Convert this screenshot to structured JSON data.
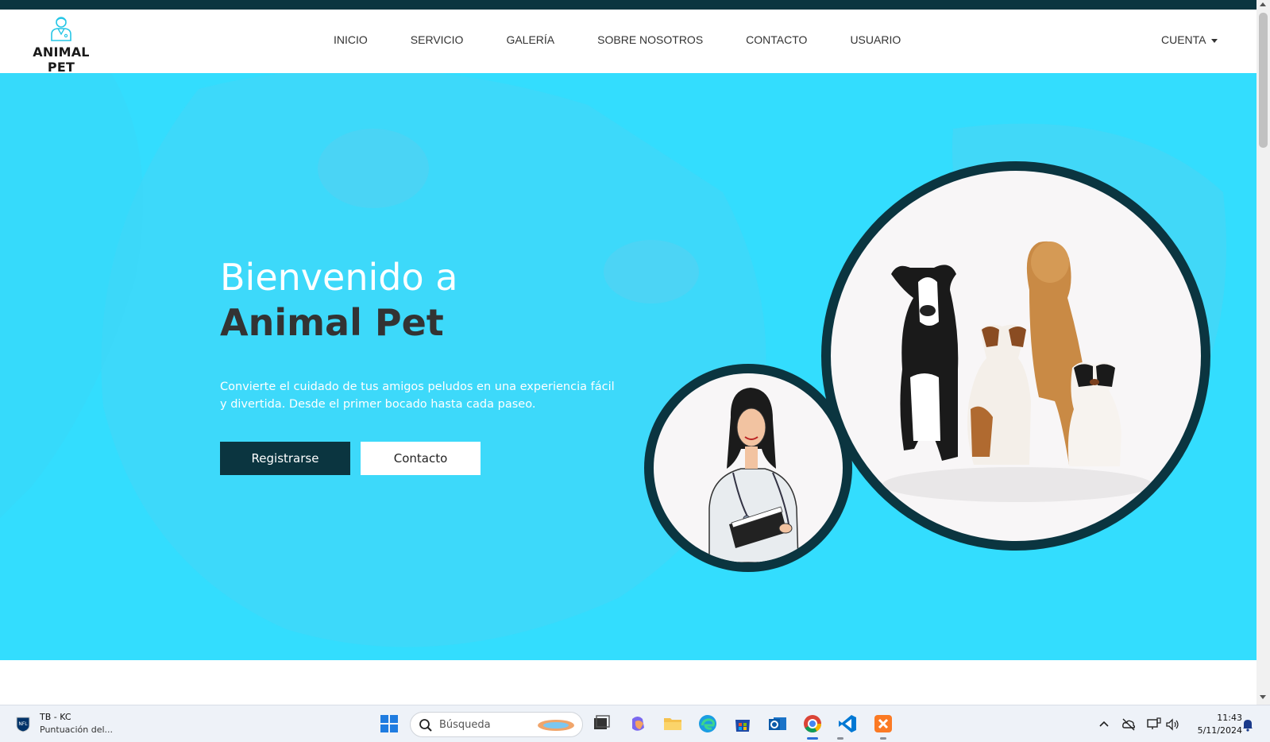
{
  "navbar": {
    "brand": "ANIMAL PET",
    "links": [
      "INICIO",
      "SERVICIO",
      "GALERÍA",
      "SOBRE NOSOTROS",
      "CONTACTO",
      "USUARIO"
    ],
    "account_label": "CUENTA"
  },
  "hero": {
    "title_line1": "Bienvenido a",
    "title_line2": "Animal Pet",
    "description": "Convierte el cuidado de tus amigos peludos en una experiencia fácil y divertida. Desde el primer bocado hasta cada paseo.",
    "primary_button": "Registrarse",
    "secondary_button": "Contacto"
  },
  "taskbar": {
    "widget_title": "TB - KC",
    "widget_subtitle": "Puntuación del...",
    "search_placeholder": "Búsqueda",
    "time": "11:43",
    "date": "5/11/2024"
  },
  "colors": {
    "hero_background": "#33ddfe",
    "dark_accent": "#0b3540",
    "circle_fill": "#f8f6f7"
  }
}
